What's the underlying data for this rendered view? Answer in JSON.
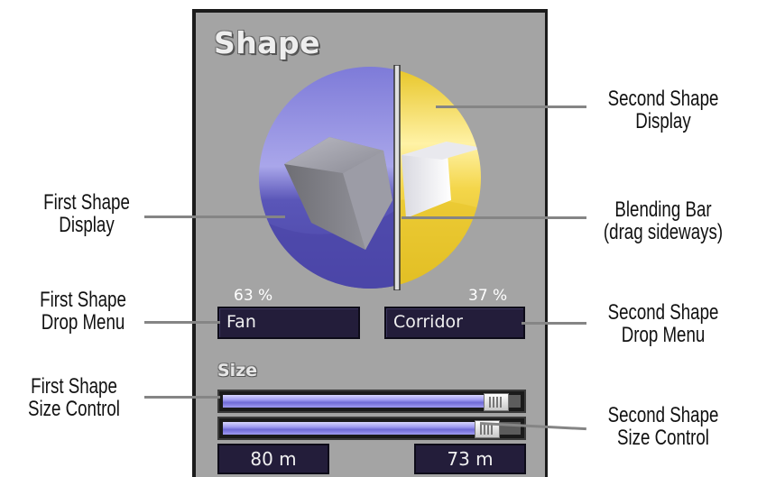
{
  "panel": {
    "title": "Shape",
    "first_percent": "63 %",
    "second_percent": "37 %",
    "first_shape": "Fan",
    "second_shape": "Corridor",
    "size_label": "Size",
    "first_size": "80 m",
    "second_size": "73 m",
    "first_size_level": 0.93,
    "second_size_level": 0.9,
    "blend_position": 0.63
  },
  "callouts": {
    "first_display": [
      "First Shape",
      "Display"
    ],
    "second_display": [
      "Second Shape",
      "Display"
    ],
    "blending_bar": [
      "Blending Bar",
      "(drag sideways)"
    ],
    "first_menu": [
      "First Shape",
      "Drop Menu"
    ],
    "second_menu": [
      "Second Shape",
      "Drop Menu"
    ],
    "first_size": [
      "First Shape",
      "Size Control"
    ],
    "second_size": [
      "Second Shape",
      "Size Control"
    ]
  },
  "colors": {
    "panel": "#a4a4a4",
    "first_display": "#5a56b8",
    "second_display": "#f2d23a",
    "menu": "#231d3a",
    "slider_fill": "#9f9bf0",
    "leader": "#858585"
  }
}
